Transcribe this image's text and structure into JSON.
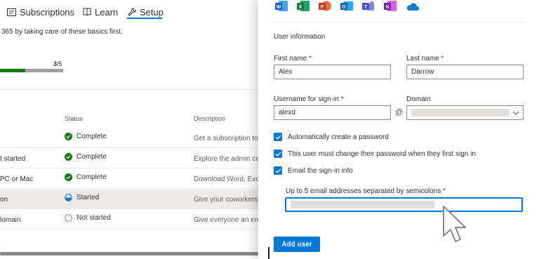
{
  "tabs": [
    {
      "label": "Subscriptions",
      "icon": "subscriptions-icon"
    },
    {
      "label": "Learn",
      "icon": "book-icon"
    },
    {
      "label": "Setup",
      "icon": "wrench-icon",
      "active": true
    }
  ],
  "intro_text": "365 by taking care of these basics first.",
  "progress": {
    "done": "3",
    "sep": "/",
    "total": "5",
    "fraction": 0.4
  },
  "table": {
    "headers": {
      "status": "Status",
      "description": "Description"
    },
    "rows": [
      {
        "name": "",
        "status": "Complete",
        "status_type": "complete",
        "description": "Get a subscription to N"
      },
      {
        "name": "t started",
        "status": "Complete",
        "status_type": "complete",
        "description": "Explore the admin cen"
      },
      {
        "name": "PC or Mac",
        "status": "Complete",
        "status_type": "complete",
        "description": "Download Word, Excel"
      },
      {
        "name": "on",
        "status": "Started",
        "status_type": "started",
        "description": "Give your coworkers a",
        "selected": true
      },
      {
        "name": "lomain",
        "status": "Not started",
        "status_type": "not-started",
        "description": "Give everyone an ema"
      }
    ]
  },
  "panel": {
    "apps": [
      "word-icon",
      "excel-icon",
      "powerpoint-icon",
      "outlook-icon",
      "teams-icon",
      "onenote-icon",
      "onedrive-icon"
    ],
    "section_title": "User information",
    "first_name": {
      "label": "First name",
      "required": "*",
      "value": "Alex"
    },
    "last_name": {
      "label": "Last name",
      "required": "*",
      "value": "Darrow"
    },
    "username": {
      "label": "Username for sign-in",
      "required": "*",
      "value": "alexd"
    },
    "at_symbol": "@",
    "domain": {
      "label": "Domain"
    },
    "checkboxes": [
      {
        "label": "Automatically create a password",
        "checked": true
      },
      {
        "label": "This user must change their password when they first sign in",
        "checked": true
      },
      {
        "label": "Email the sign-in info",
        "checked": true
      }
    ],
    "email_field": {
      "label": "Up to 5 email addresses separated by semicolons",
      "required": "*"
    },
    "add_user_label": "Add user"
  },
  "colors": {
    "accent": "#0078d4",
    "complete": "#107c10",
    "required": "#a4262c"
  }
}
